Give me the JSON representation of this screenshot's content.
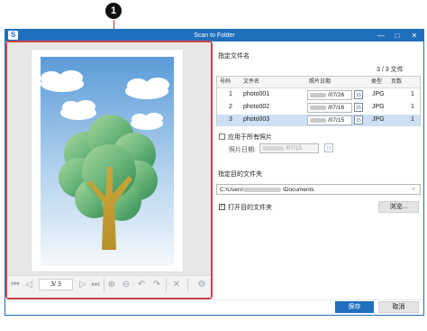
{
  "callout": {
    "number": "1"
  },
  "window": {
    "title": "Scan to Folder",
    "app_icon_glyph": "S",
    "minimize_glyph": "—",
    "maximize_glyph": "□",
    "close_glyph": "✕"
  },
  "preview": {
    "page_current": "3",
    "page_sep": "/",
    "page_total": "3"
  },
  "filename_section": {
    "label": "指定文件名",
    "count_text": "3 /   3 文件"
  },
  "table": {
    "headers": {
      "number": "号码",
      "filename": "文件名",
      "photo_date": "照片日期",
      "type": "类型",
      "pages": "页数"
    },
    "rows": [
      {
        "number": "1",
        "filename": "photo001",
        "date_suffix": "/07/26",
        "cal_day": "15",
        "type": "JPG",
        "pages": "1"
      },
      {
        "number": "2",
        "filename": "photo002",
        "date_suffix": "/07/16",
        "cal_day": "15",
        "type": "JPG",
        "pages": "1"
      },
      {
        "number": "3",
        "filename": "photo003",
        "date_suffix": "/07/15",
        "cal_day": "15",
        "type": "JPG",
        "pages": "1"
      }
    ]
  },
  "apply_all": {
    "label": "应用于所有照片",
    "checked": false
  },
  "photo_date_field": {
    "label": "照片日期:",
    "value_suffix": "/07/15",
    "cal_day": "15"
  },
  "dest_section": {
    "label": "指定目的文件夹",
    "path_prefix": "C:\\Users\\",
    "path_suffix": "\\Documents",
    "dropdown_glyph": "⌄"
  },
  "open_folder": {
    "label": "打开目的文件夹",
    "checked": true,
    "check_glyph": "✓"
  },
  "browse_button": {
    "label": "浏览..."
  },
  "footer": {
    "save_label": "保存",
    "cancel_label": "取消"
  },
  "toolbar_glyphs": {
    "first": "⏮",
    "prev": "◁",
    "next": "▷",
    "last": "⏭",
    "zoom_in": "⊕",
    "zoom_out": "⊖",
    "rotate_left": "↶",
    "rotate_right": "↷",
    "delete": "✕",
    "settings": "⚙"
  },
  "colors": {
    "accent": "#1f6fbd",
    "callout_red": "#c8454f",
    "selection": "#cfe0f5"
  }
}
